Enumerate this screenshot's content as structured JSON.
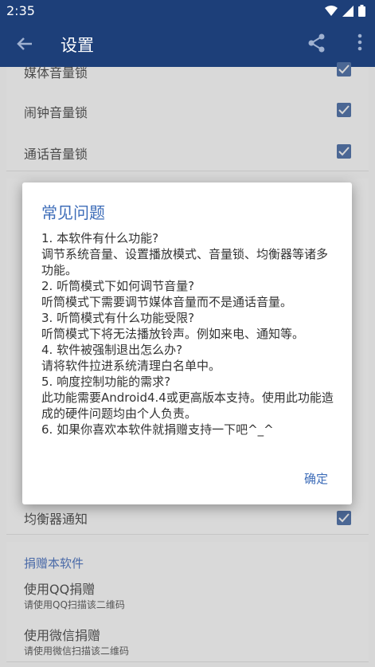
{
  "status": {
    "time": "2:35"
  },
  "appbar": {
    "title": "设置"
  },
  "background": {
    "rows": [
      "媒体音量锁",
      "闹钟音量锁",
      "通话音量锁",
      "均衡器通知"
    ],
    "donate": {
      "title": "捐赠本软件",
      "qq_title": "使用QQ捐赠",
      "qq_sub": "请使用QQ扫描该二维码",
      "wx_title": "使用微信捐赠",
      "wx_sub": "请使用微信扫描该二维码"
    }
  },
  "dialog": {
    "title": "常见问题",
    "body": "1. 本软件有什么功能?\n调节系统音量、设置播放模式、音量锁、均衡器等诸多功能。\n2. 听筒模式下如何调节音量?\n听筒模式下需要调节媒体音量而不是通话音量。\n3. 听筒模式有什么功能受限?\n听筒模式下将无法播放铃声。例如来电、通知等。\n4. 软件被强制退出怎么办?\n请将软件拉进系统清理白名单中。\n5. 响度控制功能的需求?\n此功能需要Android4.4或更高版本支持。使用此功能造成的硬件问题均由个人负责。\n6. 如果你喜欢本软件就捐赠支持一下吧^_^",
    "ok_label": "确定"
  }
}
